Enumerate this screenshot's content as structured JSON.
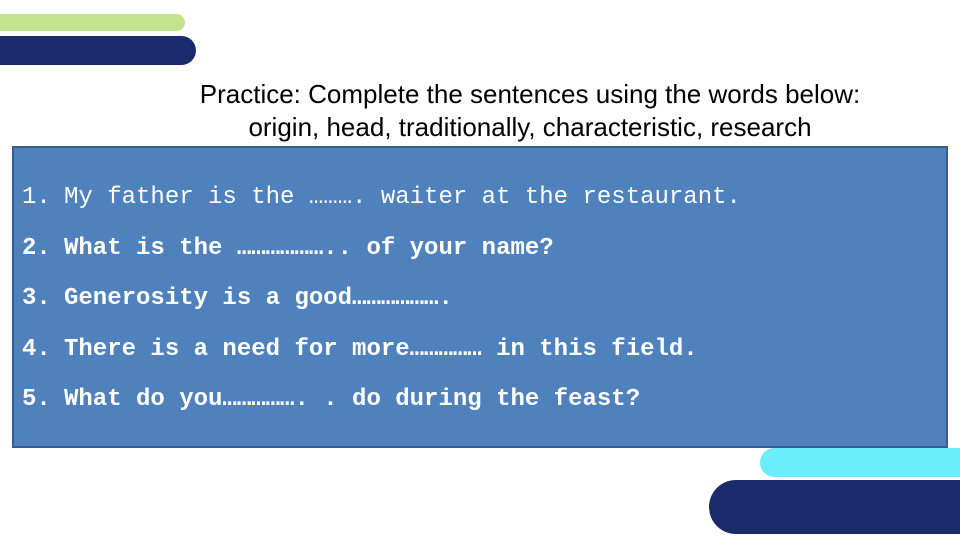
{
  "slide": {
    "title_line1": "Practice: Complete the sentences using the words below:",
    "title_line2": "origin, head, traditionally, characteristic, research",
    "colors": {
      "box_fill": "#4f81bd",
      "box_border": "#385d8a",
      "accent_green": "#c1e48c",
      "accent_navy": "#1b2a6b",
      "accent_cyan": "#6aeefc"
    },
    "sentences": [
      {
        "number": "1.",
        "text": "My father is the ………. waiter at the restaurant."
      },
      {
        "number": "2.",
        "text": "What is the ……………….. of your name?"
      },
      {
        "number": "3.",
        "text": "Generosity is a good………………."
      },
      {
        "number": "4.",
        "text": "There is a need for more…………… in this field."
      },
      {
        "number": "5.",
        "text": "What do you……………. . do during the feast?"
      }
    ]
  }
}
